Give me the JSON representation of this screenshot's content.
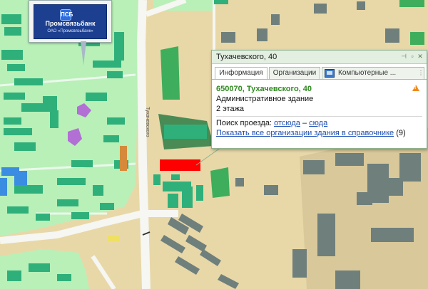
{
  "map": {
    "street_label": "Тухачевского",
    "colors": {
      "land": "#e8d8a8",
      "residential": "#b8f0b8",
      "building": "#2fb07a",
      "industrial": "#7a8a88",
      "park": "#4a8a55",
      "highlight": "#ff0000",
      "road": "#f6f6f2"
    }
  },
  "ad": {
    "logo_text": "ПСБ",
    "name": "Промсвязьбанк",
    "subtitle": "ОАО «Промсвязьбанк»"
  },
  "popup": {
    "title": "Тухачевского, 40",
    "tabs": [
      {
        "label": "Информация",
        "active": true
      },
      {
        "label": "Организации",
        "active": false
      },
      {
        "label": "Компьютерные ...",
        "active": false,
        "icon": "computer-icon"
      }
    ],
    "address": "650070, Тухачевского, 40",
    "building_type": "Административное здание",
    "floors": "2 этажа",
    "route_label": "Поиск проезда:",
    "route_from": "отсюда",
    "route_dash": "–",
    "route_to": "сюда",
    "show_all_link": "Показать все организации здания в справочнике",
    "org_count": "(9)",
    "warning_icon": "warning-icon"
  }
}
